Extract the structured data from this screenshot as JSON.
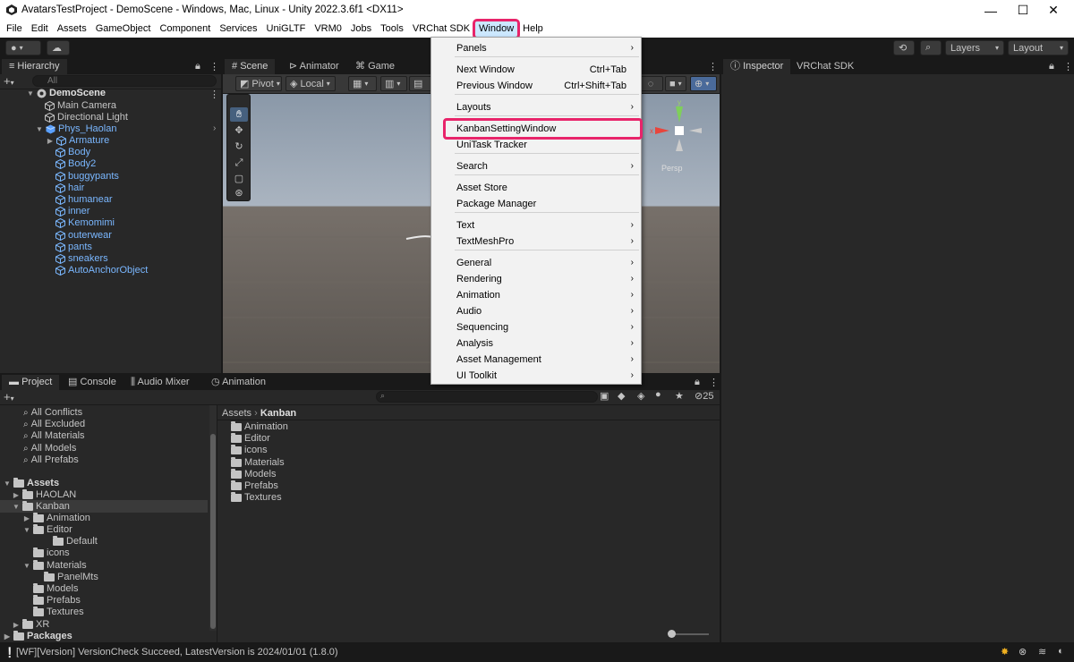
{
  "window": {
    "title": "AvatarsTestProject - DemoScene - Windows, Mac, Linux - Unity 2022.3.6f1 <DX11>",
    "minimize": "—",
    "maximize": "☐",
    "close": "✕"
  },
  "menubar": [
    "File",
    "Edit",
    "Assets",
    "GameObject",
    "Component",
    "Services",
    "UniGLTF",
    "VRM0",
    "Jobs",
    "Tools",
    "VRChat SDK",
    "Window",
    "Help"
  ],
  "toolbar": {
    "layers_label": "Layers",
    "layout_label": "Layout"
  },
  "hierarchy": {
    "tab": "Hierarchy",
    "search_placeholder": "All",
    "scene": "DemoScene",
    "items": [
      "Main Camera",
      "Directional Light"
    ],
    "avatar": "Phys_Haolan",
    "children": [
      "Armature",
      "Body",
      "Body2",
      "buggypants",
      "hair",
      "humanear",
      "inner",
      "Kemomimi",
      "outerwear",
      "pants",
      "sneakers",
      "AutoAnchorObject"
    ]
  },
  "scene_view": {
    "tabs": [
      "Scene",
      "Animator",
      "Game"
    ],
    "pivot": "Pivot",
    "local": "Local",
    "persp": "Persp"
  },
  "inspector": {
    "tabs": [
      "Inspector",
      "VRChat SDK"
    ]
  },
  "window_menu": {
    "items": [
      {
        "label": "Panels",
        "shortcut": "",
        "sub": true
      },
      {
        "label": "Next Window",
        "shortcut": "Ctrl+Tab",
        "sub": false
      },
      {
        "label": "Previous Window",
        "shortcut": "Ctrl+Shift+Tab",
        "sub": false
      },
      {
        "label": "Layouts",
        "shortcut": "",
        "sub": true
      },
      {
        "label": "KanbanSettingWindow",
        "shortcut": "",
        "sub": false
      },
      {
        "label": "UniTask Tracker",
        "shortcut": "",
        "sub": false
      },
      {
        "label": "Search",
        "shortcut": "",
        "sub": true
      },
      {
        "label": "Asset Store",
        "shortcut": "",
        "sub": false
      },
      {
        "label": "Package Manager",
        "shortcut": "",
        "sub": false
      },
      {
        "label": "Text",
        "shortcut": "",
        "sub": true
      },
      {
        "label": "TextMeshPro",
        "shortcut": "",
        "sub": true
      },
      {
        "label": "General",
        "shortcut": "",
        "sub": true
      },
      {
        "label": "Rendering",
        "shortcut": "",
        "sub": true
      },
      {
        "label": "Animation",
        "shortcut": "",
        "sub": true
      },
      {
        "label": "Audio",
        "shortcut": "",
        "sub": true
      },
      {
        "label": "Sequencing",
        "shortcut": "",
        "sub": true
      },
      {
        "label": "Analysis",
        "shortcut": "",
        "sub": true
      },
      {
        "label": "Asset Management",
        "shortcut": "",
        "sub": true
      },
      {
        "label": "UI Toolkit",
        "shortcut": "",
        "sub": true
      }
    ]
  },
  "project": {
    "tabs": [
      "Project",
      "Console",
      "Audio Mixer",
      "Animation"
    ],
    "hidden_count": "25",
    "favorites": [
      "All Conflicts",
      "All Excluded",
      "All Materials",
      "All Models",
      "All Prefabs"
    ],
    "tree": [
      {
        "label": "Assets",
        "bold": true
      },
      {
        "label": "HAOLAN"
      },
      {
        "label": "Kanban"
      },
      {
        "label": "Animation"
      },
      {
        "label": "Editor"
      },
      {
        "label": "Default"
      },
      {
        "label": "icons"
      },
      {
        "label": "Materials"
      },
      {
        "label": "PanelMts"
      },
      {
        "label": "Models"
      },
      {
        "label": "Prefabs"
      },
      {
        "label": "Textures"
      },
      {
        "label": "XR"
      },
      {
        "label": "Packages",
        "bold": true
      }
    ],
    "breadcrumb": [
      "Assets",
      "Kanban"
    ],
    "folders": [
      "Animation",
      "Editor",
      "icons",
      "Materials",
      "Models",
      "Prefabs",
      "Textures"
    ]
  },
  "status": {
    "message": "[WF][Version] VersionCheck Succeed, LatestVersion is 2024/01/01 (1.8.0)"
  },
  "colors": {
    "highlight": "#e8246a",
    "blue_text": "#7ab7ff",
    "menu_bg": "#f2f2f2"
  }
}
